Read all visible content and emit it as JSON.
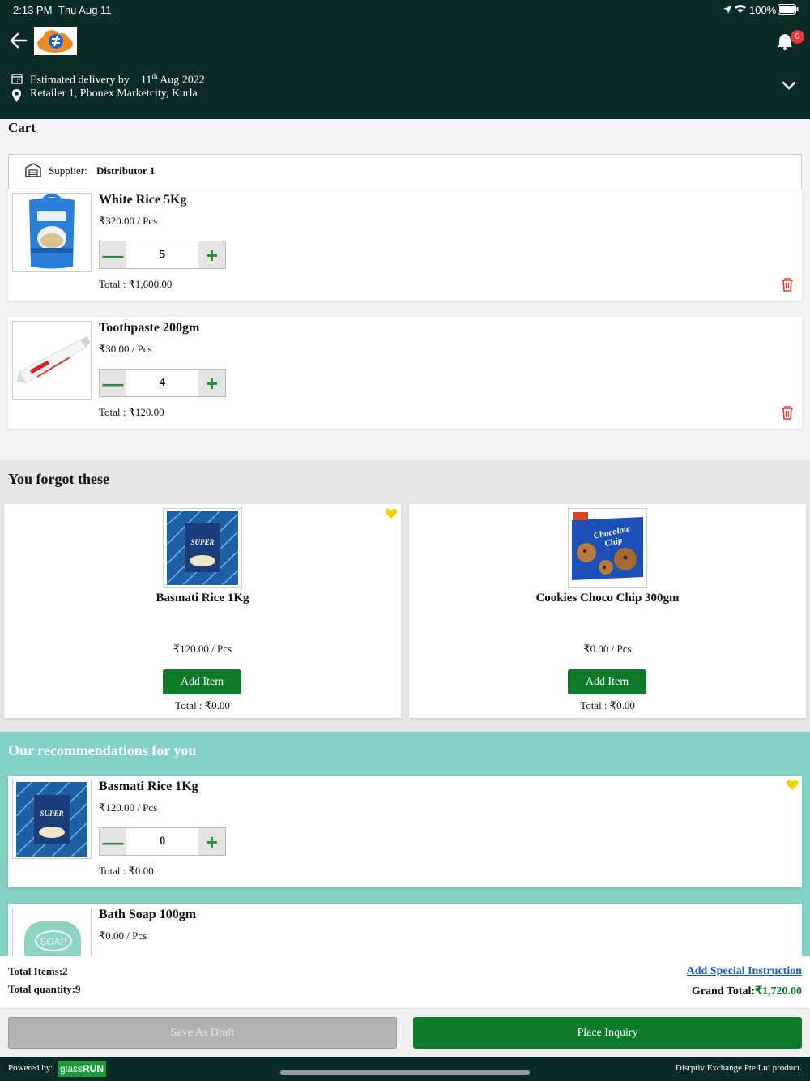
{
  "status_bar": {
    "time": "2:13 PM",
    "date": "Thu Aug 11",
    "battery": "100%"
  },
  "header": {
    "notification_count": "0",
    "delivery_label": "Estimated delivery by",
    "delivery_day": "11",
    "delivery_sup": "th",
    "delivery_rest": "Aug 2022",
    "location": "Retailer 1, Phonex Marketcity, Kurla"
  },
  "cart": {
    "title": "Cart",
    "supplier_label": "Supplier:",
    "supplier_name": "Distributor 1",
    "items": [
      {
        "name": "White Rice 5Kg",
        "price": "₹320.00 / Pcs",
        "qty": "5",
        "total": "Total : ₹1,600.00"
      },
      {
        "name": "Toothpaste 200gm",
        "price": "₹30.00 / Pcs",
        "qty": "4",
        "total": "Total : ₹120.00"
      }
    ]
  },
  "forgot": {
    "title": "You forgot these",
    "items": [
      {
        "name": "Basmati Rice 1Kg",
        "price": "₹120.00 / Pcs",
        "button": "Add Item",
        "total": "Total : ₹0.00"
      },
      {
        "name": "Cookies Choco Chip 300gm",
        "price": "₹0.00 / Pcs",
        "button": "Add Item",
        "total": "Total : ₹0.00"
      }
    ]
  },
  "recommendations": {
    "title": "Our recommendations for you",
    "items": [
      {
        "name": "Basmati Rice 1Kg",
        "price": "₹120.00 / Pcs",
        "qty": "0",
        "total": "Total : ₹0.00"
      },
      {
        "name": "Bath Soap 100gm",
        "price": "₹0.00 / Pcs"
      }
    ]
  },
  "summary": {
    "total_items": "Total Items:2",
    "total_quantity": "Total quantity:9",
    "special_instruction": "Add Special Instruction",
    "grand_total_label": "Grand Total:",
    "grand_total_value": "₹1,720.00"
  },
  "actions": {
    "draft": "Save As Draft",
    "place": "Place Inquiry"
  },
  "footer": {
    "powered_by": "Powered by:",
    "brand_a": "glass",
    "brand_b": "RUN",
    "company": "Disrptiv Exchange Pte Ltd product."
  },
  "colors": {
    "header_bg": "#0c2a26",
    "accent_green": "#0e7a2a",
    "rec_bg": "#84d1c5",
    "delete_red": "#e53935",
    "heart_yellow": "#f2d300"
  }
}
